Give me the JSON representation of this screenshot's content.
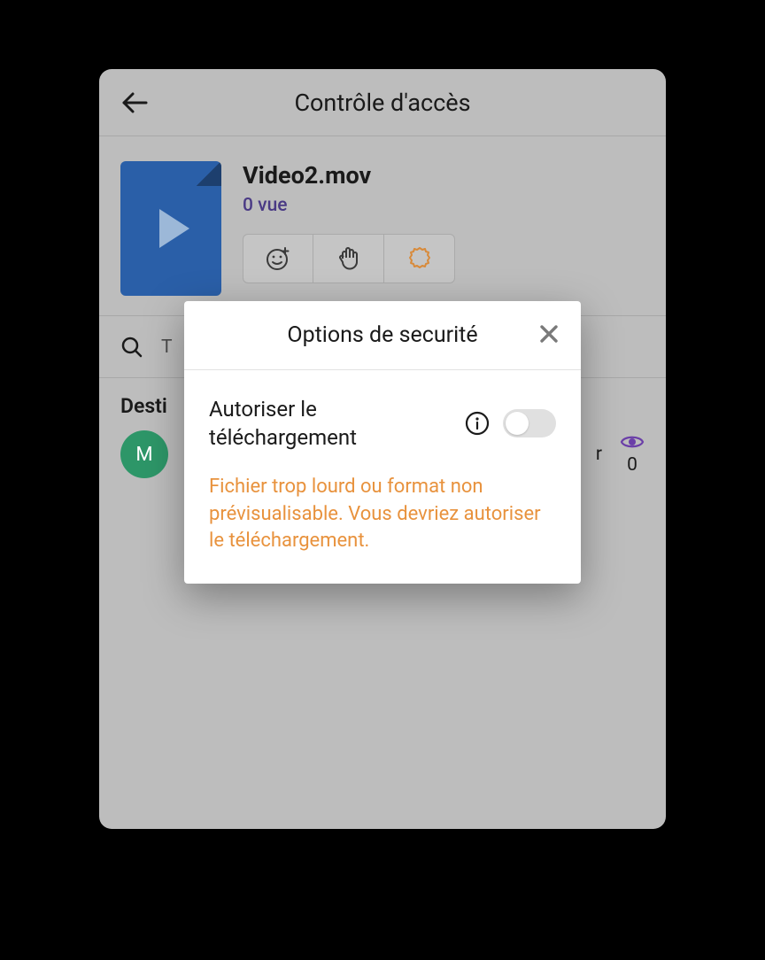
{
  "header": {
    "title": "Contrôle d'accès"
  },
  "file": {
    "name": "Video2.mov",
    "views": "0 vue"
  },
  "search": {
    "placeholder_fragment": "T"
  },
  "recipients": {
    "section_label": "Desti",
    "items": [
      {
        "initial": "M",
        "truncated_right": "r",
        "views": "0"
      }
    ]
  },
  "modal": {
    "title": "Options de securité",
    "toggle_label": "Autoriser le téléchargement",
    "toggle_on": false,
    "warning": "Fichier trop lourd ou format non prévisualisable. Vous devriez autoriser le téléchargement."
  },
  "icons": {
    "emoji": "emoji-add-icon",
    "hand": "hand-icon",
    "gear": "gear-badge-icon"
  }
}
